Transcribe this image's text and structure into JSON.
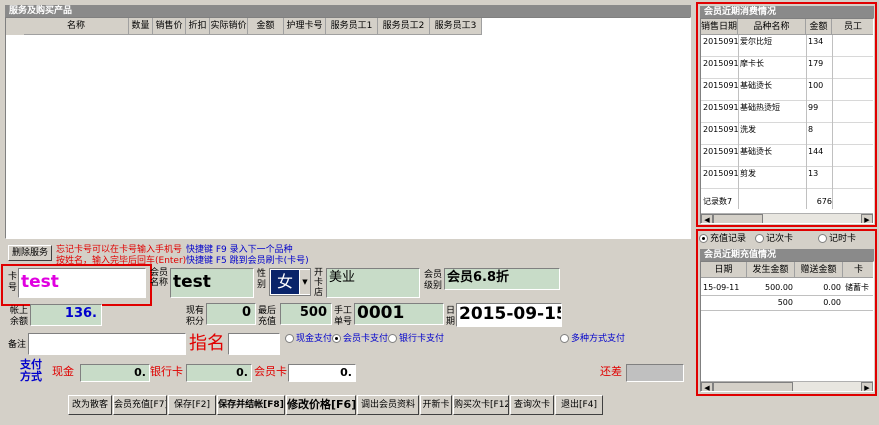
{
  "products": {
    "title": "服务及购买产品",
    "columns": [
      "名称",
      "数量",
      "销售价",
      "折扣",
      "实际销价",
      "金额",
      "护理卡号",
      "服务员工1",
      "服务员工2",
      "服务员工3"
    ]
  },
  "hints": {
    "delete_button": "删除服务",
    "line1_red": "忘记卡号可以在卡号输入手机号",
    "line1_blue": "快捷键 F9 录入下一个品种",
    "line2_red": "按姓名，输入完毕后回车(Enter)",
    "line2_blue": "快捷键 F5 跳到会员刷卡(卡号)"
  },
  "form": {
    "card_no_label": "卡号",
    "card_no_value": "test",
    "member_name_label": "会员名称",
    "member_name_value": "test",
    "gender_label": "性别",
    "gender_value": "女",
    "store_label": "开卡店",
    "store_value": "美业",
    "level_label": "会员级别",
    "level_value": "会员6.8折",
    "balance_label": "帐上余额",
    "balance_value": "136.",
    "points_label": "现有积分",
    "points_value": "0",
    "last_recharge_label": "最后充值",
    "last_recharge_value": "500",
    "manual_no_label": "手工单号",
    "manual_no_value": "0001",
    "date_label": "日期",
    "date_value": "2015-09-15",
    "note_label": "备注",
    "appoint_label": "指名",
    "pay_cash_label": "现金支付",
    "pay_card_label": "会员卡支付",
    "pay_bank_label": "银行卡支付",
    "pay_multi_label": "多种方式支付",
    "pay_method_label": "支付方式",
    "cash_label": "现金",
    "cash_value": "0.",
    "bank_label": "银行卡",
    "bank_value": "0.",
    "member_card_label": "会员卡",
    "member_card_value": "0.",
    "remaining_label": "还差"
  },
  "toolbar": {
    "buttons": [
      "改为散客",
      "会员充值[F7]",
      "保存[F2]",
      "保存并结帐[F8]",
      "修改价格[F6]",
      "调出会员资料",
      "开新卡",
      "购买次卡[F12]",
      "查询次卡",
      "退出[F4]"
    ]
  },
  "recent": {
    "title": "会员近期消费情况",
    "columns": [
      "销售日期",
      "品种名称",
      "金额",
      "员工"
    ],
    "rows": [
      [
        "20150915",
        "爱尔比短",
        "134"
      ],
      [
        "20150915",
        "摩卡长",
        "179"
      ],
      [
        "20150914",
        "基础烫长",
        "100"
      ],
      [
        "20150914",
        "基础热烫短",
        "99"
      ],
      [
        "20150914",
        "洗发",
        "8"
      ],
      [
        "20150914",
        "基础烫长",
        "144"
      ],
      [
        "20150911",
        "剪发",
        "13"
      ]
    ],
    "footer_label": "记录数7",
    "footer_total": "676"
  },
  "tabs": {
    "recharge": "充值记录",
    "times_card": "记次卡",
    "time_card": "记时卡"
  },
  "recharge": {
    "title": "会员近期充值情况",
    "columns": [
      "日期",
      "发生金额",
      "赠送金额",
      "卡"
    ],
    "rows": [
      [
        "15-09-11",
        "500.00",
        "0.00",
        "储蓄卡"
      ]
    ],
    "total_amount": "500",
    "total_gift": "0.00"
  }
}
